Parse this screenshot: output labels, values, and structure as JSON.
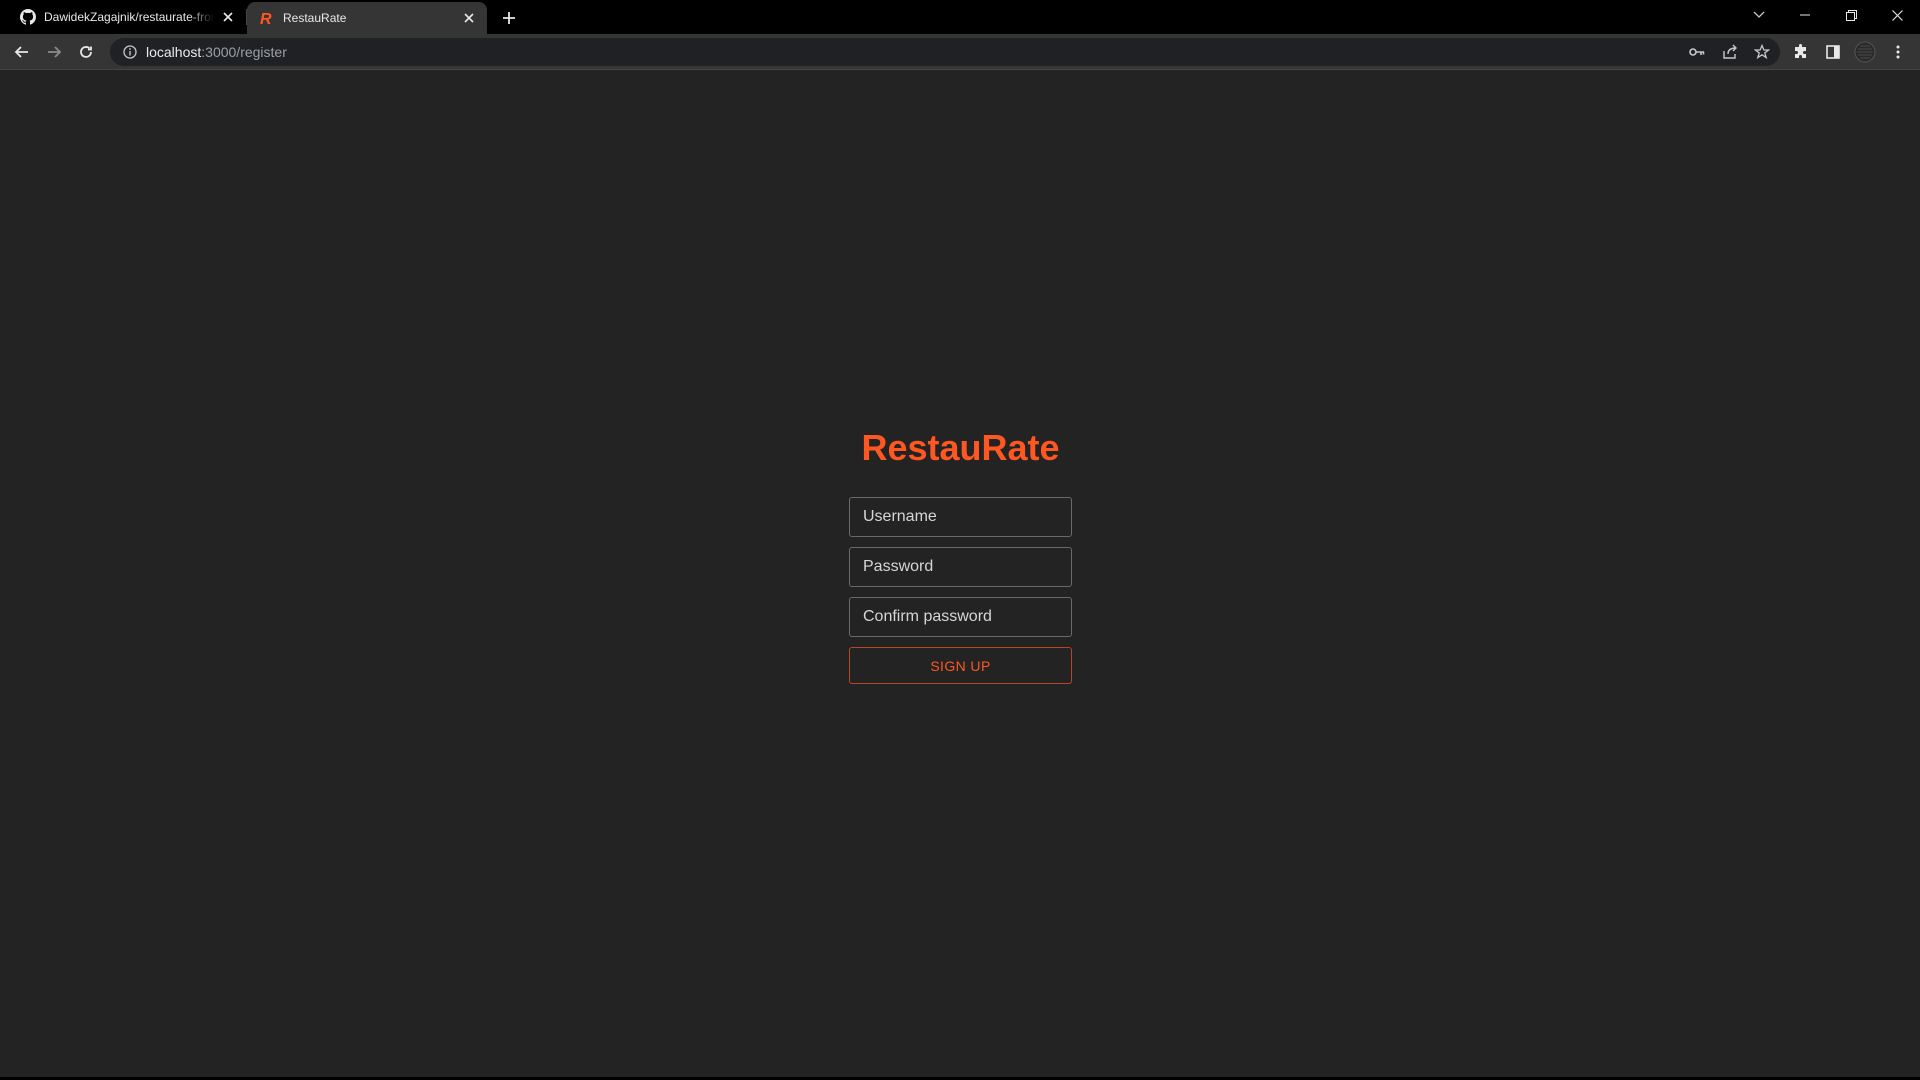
{
  "browser": {
    "tabs": [
      {
        "title": "DawidekZagajnik/restaurate-fron",
        "favicon": "github-icon",
        "active": false
      },
      {
        "title": "RestauRate",
        "favicon": "restaurate-r-icon",
        "active": true
      }
    ],
    "address": {
      "host": "localhost",
      "path": ":3000/register"
    },
    "icons": [
      "back-arrow-icon",
      "forward-arrow-icon",
      "reload-icon",
      "info-icon",
      "key-icon",
      "share-icon",
      "star-icon",
      "extensions-icon",
      "side-panel-icon",
      "profile-avatar",
      "kebab-menu-icon"
    ]
  },
  "app": {
    "brand": "RestauRate",
    "accent_color": "#ff5722",
    "fields": {
      "username": {
        "placeholder": "Username",
        "value": ""
      },
      "password": {
        "placeholder": "Password",
        "value": ""
      },
      "confirm": {
        "placeholder": "Confirm password",
        "value": ""
      }
    },
    "submit_label": "SIGN UP"
  }
}
